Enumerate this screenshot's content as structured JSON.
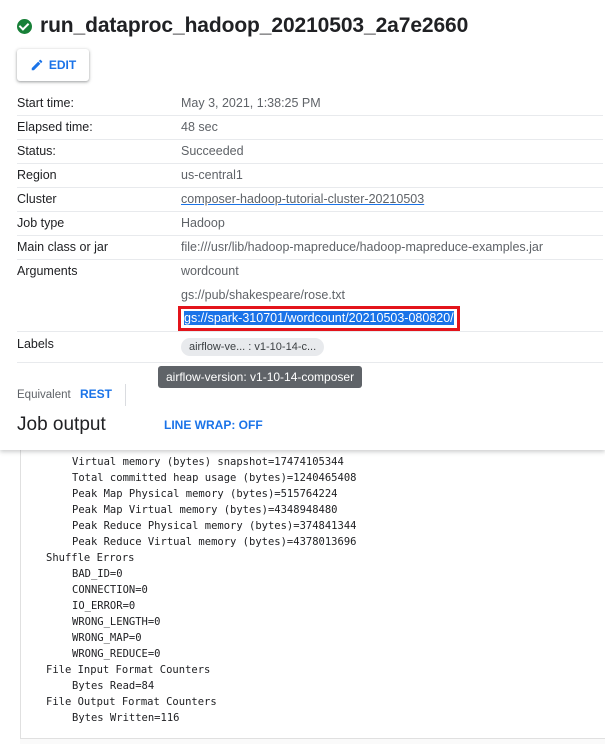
{
  "job": {
    "title": "run_dataproc_hadoop_20210503_2a7e2660",
    "status_color": "#188038"
  },
  "toolbar": {
    "edit_label": "EDIT"
  },
  "details": {
    "start_time": {
      "label": "Start time:",
      "value": "May 3, 2021, 1:38:25 PM"
    },
    "elapsed_time": {
      "label": "Elapsed time:",
      "value": "48 sec"
    },
    "status": {
      "label": "Status:",
      "value": "Succeeded"
    },
    "region": {
      "label": "Region",
      "value": "us-central1"
    },
    "cluster": {
      "label": "Cluster",
      "value": "composer-hadoop-tutorial-cluster-20210503"
    },
    "job_type": {
      "label": "Job type",
      "value": "Hadoop"
    },
    "main_class": {
      "label": "Main class or jar",
      "value": "file:///usr/lib/hadoop-mapreduce/hadoop-mapreduce-examples.jar"
    },
    "arguments": {
      "label": "Arguments",
      "values": [
        "wordcount",
        "gs://pub/shakespeare/rose.txt",
        "gs://spark-310701/wordcount/20210503-080820/"
      ]
    },
    "labels": {
      "label": "Labels",
      "chip": "airflow-ve... : v1-10-14-c...",
      "tooltip": "airflow-version: v1-10-14-composer"
    }
  },
  "equivalent": {
    "label": "Equivalent",
    "rest_label": "REST"
  },
  "output": {
    "heading": "Job output",
    "line_wrap_label": "LINE WRAP: OFF",
    "lines": [
      {
        "indent": 2,
        "text": "Virtual memory (bytes) snapshot=17474105344"
      },
      {
        "indent": 2,
        "text": "Total committed heap usage (bytes)=1240465408"
      },
      {
        "indent": 2,
        "text": "Peak Map Physical memory (bytes)=515764224"
      },
      {
        "indent": 2,
        "text": "Peak Map Virtual memory (bytes)=4348948480"
      },
      {
        "indent": 2,
        "text": "Peak Reduce Physical memory (bytes)=374841344"
      },
      {
        "indent": 2,
        "text": "Peak Reduce Virtual memory (bytes)=4378013696"
      },
      {
        "indent": 1,
        "text": "Shuffle Errors"
      },
      {
        "indent": 2,
        "text": "BAD_ID=0"
      },
      {
        "indent": 2,
        "text": "CONNECTION=0"
      },
      {
        "indent": 2,
        "text": "IO_ERROR=0"
      },
      {
        "indent": 2,
        "text": "WRONG_LENGTH=0"
      },
      {
        "indent": 2,
        "text": "WRONG_MAP=0"
      },
      {
        "indent": 2,
        "text": "WRONG_REDUCE=0"
      },
      {
        "indent": 1,
        "text": "File Input Format Counters"
      },
      {
        "indent": 2,
        "text": "Bytes Read=84"
      },
      {
        "indent": 1,
        "text": "File Output Format Counters"
      },
      {
        "indent": 2,
        "text": "Bytes Written=116"
      }
    ]
  }
}
